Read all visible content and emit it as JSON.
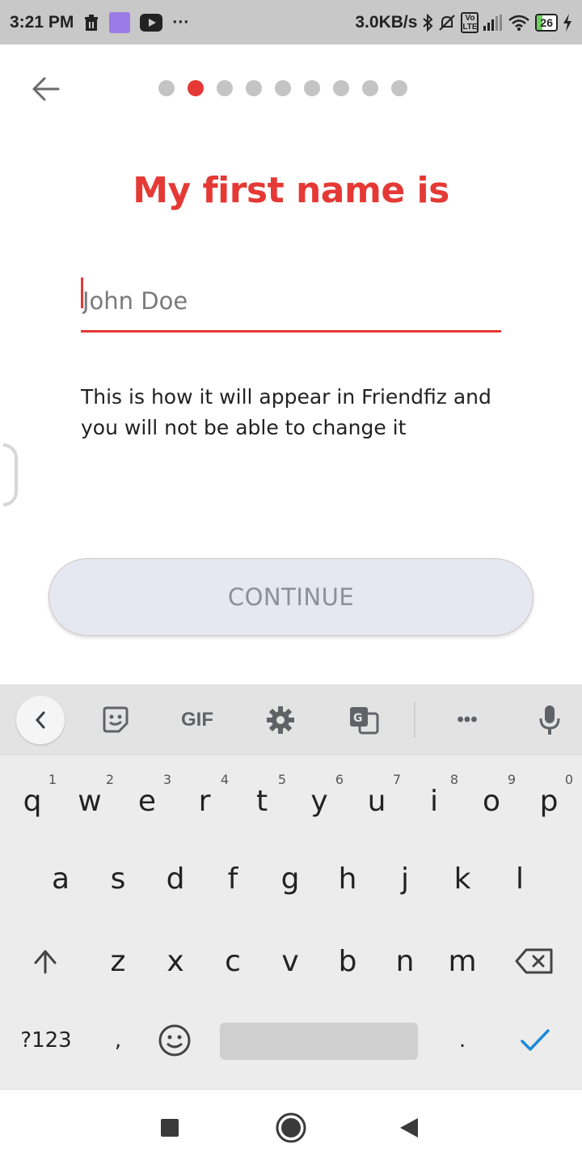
{
  "status_bar": {
    "time": "3:21 PM",
    "speed": "3.0KB/s",
    "more": "···",
    "network_label": "Vo LTE",
    "battery": "26"
  },
  "nav": {
    "step_current": 2,
    "step_total": 9
  },
  "title": "My first name is",
  "name_input": {
    "placeholder": "John Doe",
    "value": ""
  },
  "helper_text": "This is how it will appear in Friendfiz and you will not be able to change it",
  "continue_label": "CONTINUE",
  "keyboard": {
    "toolbar": {
      "gif_label": "GIF",
      "more_label": "•••"
    },
    "row1": [
      {
        "k": "q",
        "h": "1"
      },
      {
        "k": "w",
        "h": "2"
      },
      {
        "k": "e",
        "h": "3"
      },
      {
        "k": "r",
        "h": "4"
      },
      {
        "k": "t",
        "h": "5"
      },
      {
        "k": "y",
        "h": "6"
      },
      {
        "k": "u",
        "h": "7"
      },
      {
        "k": "i",
        "h": "8"
      },
      {
        "k": "o",
        "h": "9"
      },
      {
        "k": "p",
        "h": "0"
      }
    ],
    "row2": [
      "a",
      "s",
      "d",
      "f",
      "g",
      "h",
      "j",
      "k",
      "l"
    ],
    "row3": [
      "z",
      "x",
      "c",
      "v",
      "b",
      "n",
      "m"
    ],
    "symbols_label": "?123",
    "comma_label": ",",
    "period_label": "."
  },
  "colors": {
    "accent": "#e53935",
    "button_bg": "#e5e8f0",
    "button_text": "#8a9099",
    "check": "#1a8cd8"
  }
}
